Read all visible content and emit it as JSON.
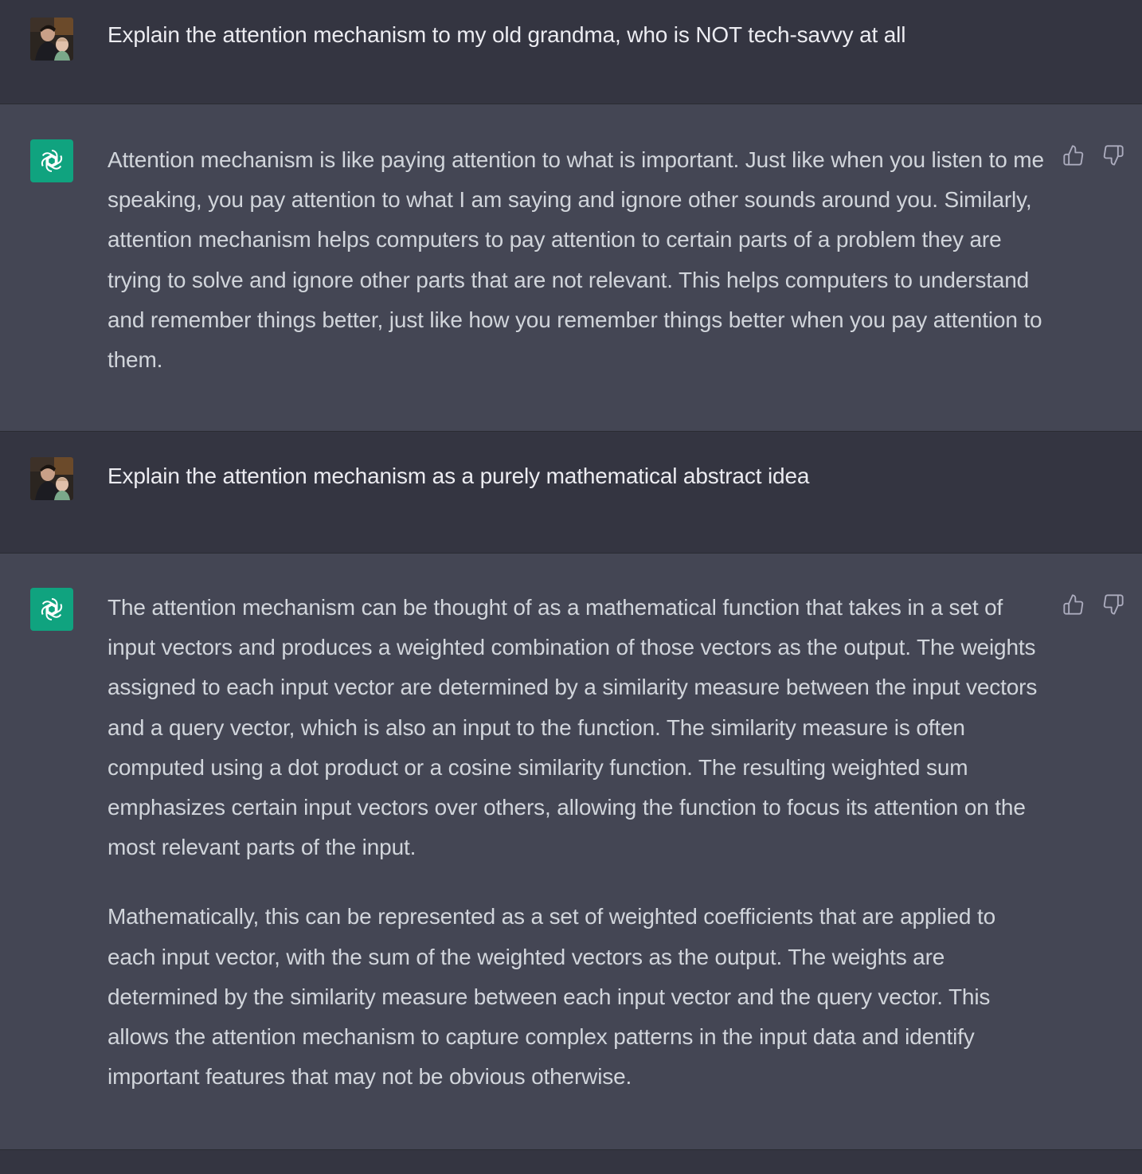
{
  "messages": [
    {
      "role": "user",
      "avatar_icon": "user-photo-avatar",
      "text": "Explain the attention mechanism to my old grandma, who is NOT tech-savvy at all"
    },
    {
      "role": "assistant",
      "avatar_icon": "openai-logo-icon",
      "paragraphs": [
        "Attention mechanism is like paying attention to what is important. Just like when you listen to me speaking, you pay attention to what I am saying and ignore other sounds around you. Similarly, attention mechanism helps computers to pay attention to certain parts of a problem they are trying to solve and ignore other parts that are not relevant. This helps computers to understand and remember things better, just like how you remember things better when you pay attention to them."
      ],
      "feedback": [
        "thumbs-up-icon",
        "thumbs-down-icon"
      ]
    },
    {
      "role": "user",
      "avatar_icon": "user-photo-avatar",
      "text": "Explain the attention mechanism as a purely mathematical abstract idea"
    },
    {
      "role": "assistant",
      "avatar_icon": "openai-logo-icon",
      "paragraphs": [
        "The attention mechanism can be thought of as a mathematical function that takes in a set of input vectors and produces a weighted combination of those vectors as the output. The weights assigned to each input vector are determined by a similarity measure between the input vectors and a query vector, which is also an input to the function. The similarity measure is often computed using a dot product or a cosine similarity function. The resulting weighted sum emphasizes certain input vectors over others, allowing the function to focus its attention on the most relevant parts of the input.",
        "Mathematically, this can be represented as a set of weighted coefficients that are applied to each input vector, with the sum of the weighted vectors as the output. The weights are determined by the similarity measure between each input vector and the query vector. This allows the attention mechanism to capture complex patterns in the input data and identify important features that may not be obvious otherwise."
      ],
      "feedback": [
        "thumbs-up-icon",
        "thumbs-down-icon"
      ]
    }
  ],
  "colors": {
    "user_bg": "#343541",
    "assistant_bg": "#444654",
    "bot_avatar": "#10a37f",
    "assistant_text": "#d1d5db",
    "user_text": "#ececf1"
  }
}
